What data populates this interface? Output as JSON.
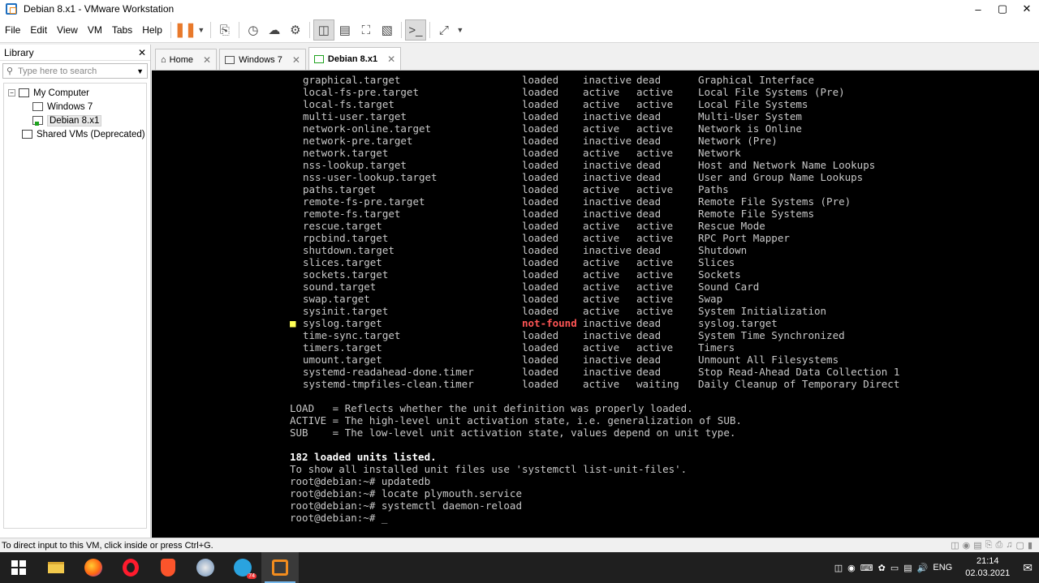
{
  "window": {
    "title": "Debian 8.x1 - VMware Workstation"
  },
  "menu": [
    "File",
    "Edit",
    "View",
    "VM",
    "Tabs",
    "Help"
  ],
  "library": {
    "title": "Library",
    "search_placeholder": "Type here to search",
    "tree": [
      {
        "label": "My Computer",
        "level": 0
      },
      {
        "label": "Windows 7",
        "level": 1
      },
      {
        "label": "Debian 8.x1",
        "level": 1,
        "selected": true
      },
      {
        "label": "Shared VMs (Deprecated)",
        "level": 0
      }
    ]
  },
  "tabs": [
    {
      "label": "Home"
    },
    {
      "label": "Windows 7"
    },
    {
      "label": "Debian 8.x1",
      "active": true
    }
  ],
  "terminal": {
    "units": [
      [
        "graphical.target",
        "loaded",
        "inactive",
        "dead",
        "Graphical Interface"
      ],
      [
        "local-fs-pre.target",
        "loaded",
        "active",
        "active",
        "Local File Systems (Pre)"
      ],
      [
        "local-fs.target",
        "loaded",
        "active",
        "active",
        "Local File Systems"
      ],
      [
        "multi-user.target",
        "loaded",
        "inactive",
        "dead",
        "Multi-User System"
      ],
      [
        "network-online.target",
        "loaded",
        "active",
        "active",
        "Network is Online"
      ],
      [
        "network-pre.target",
        "loaded",
        "inactive",
        "dead",
        "Network (Pre)"
      ],
      [
        "network.target",
        "loaded",
        "active",
        "active",
        "Network"
      ],
      [
        "nss-lookup.target",
        "loaded",
        "inactive",
        "dead",
        "Host and Network Name Lookups"
      ],
      [
        "nss-user-lookup.target",
        "loaded",
        "inactive",
        "dead",
        "User and Group Name Lookups"
      ],
      [
        "paths.target",
        "loaded",
        "active",
        "active",
        "Paths"
      ],
      [
        "remote-fs-pre.target",
        "loaded",
        "inactive",
        "dead",
        "Remote File Systems (Pre)"
      ],
      [
        "remote-fs.target",
        "loaded",
        "inactive",
        "dead",
        "Remote File Systems"
      ],
      [
        "rescue.target",
        "loaded",
        "active",
        "active",
        "Rescue Mode"
      ],
      [
        "rpcbind.target",
        "loaded",
        "active",
        "active",
        "RPC Port Mapper"
      ],
      [
        "shutdown.target",
        "loaded",
        "inactive",
        "dead",
        "Shutdown"
      ],
      [
        "slices.target",
        "loaded",
        "active",
        "active",
        "Slices"
      ],
      [
        "sockets.target",
        "loaded",
        "active",
        "active",
        "Sockets"
      ],
      [
        "sound.target",
        "loaded",
        "active",
        "active",
        "Sound Card"
      ],
      [
        "swap.target",
        "loaded",
        "active",
        "active",
        "Swap"
      ],
      [
        "sysinit.target",
        "loaded",
        "active",
        "active",
        "System Initialization"
      ],
      [
        "syslog.target",
        "not-found",
        "inactive",
        "dead",
        "syslog.target"
      ],
      [
        "time-sync.target",
        "loaded",
        "inactive",
        "dead",
        "System Time Synchronized"
      ],
      [
        "timers.target",
        "loaded",
        "active",
        "active",
        "Timers"
      ],
      [
        "umount.target",
        "loaded",
        "inactive",
        "dead",
        "Unmount All Filesystems"
      ],
      [
        "systemd-readahead-done.timer",
        "loaded",
        "inactive",
        "dead",
        "Stop Read-Ahead Data Collection 1"
      ],
      [
        "systemd-tmpfiles-clean.timer",
        "loaded",
        "active",
        "waiting",
        "Daily Cleanup of Temporary Direct"
      ]
    ],
    "legend": [
      "LOAD   = Reflects whether the unit definition was properly loaded.",
      "ACTIVE = The high-level unit activation state, i.e. generalization of SUB.",
      "SUB    = The low-level unit activation state, values depend on unit type."
    ],
    "summary": "182 loaded units listed.",
    "hint": "To show all installed unit files use 'systemctl list-unit-files'.",
    "commands": [
      "root@debian:~# updatedb",
      "root@debian:~# locate plymouth.service",
      "root@debian:~# systemctl daemon-reload",
      "root@debian:~# _"
    ]
  },
  "status": {
    "text": "To direct input to this VM, click inside or press Ctrl+G."
  },
  "taskbar": {
    "language": "ENG",
    "time": "21:14",
    "date": "02.03.2021",
    "telegram_badge": "74"
  }
}
